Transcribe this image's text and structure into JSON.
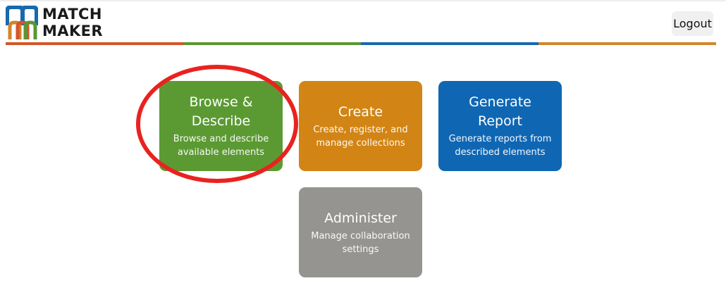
{
  "header": {
    "logo": {
      "line1": "MATCH",
      "line2": "MAKER"
    },
    "logout_label": "Logout"
  },
  "brand_colors": {
    "red": "#d2562b",
    "green": "#5a9632",
    "blue": "#1869ad",
    "orange": "#d2862b",
    "gray": "#969491"
  },
  "tiles": [
    {
      "title": "Browse & Describe",
      "description": "Browse and describe available elements",
      "color": "#5b9a32"
    },
    {
      "title": "Create",
      "description": "Create, register, and manage collections",
      "color": "#d28514"
    },
    {
      "title": "Generate Report",
      "description": "Generate reports from described elements",
      "color": "#0f67b4"
    },
    {
      "title": "Administer",
      "description": "Manage collaboration settings",
      "color": "#969490"
    }
  ],
  "annotation": {
    "highlight_color": "#e8231f",
    "highlighted_tile": "Browse & Describe"
  }
}
